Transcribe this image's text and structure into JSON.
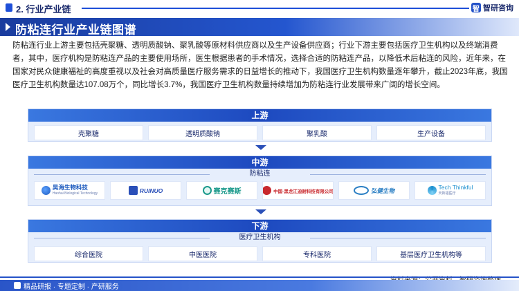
{
  "header": {
    "section_label": "2. 行业产业链",
    "brand_logo_letter": "智",
    "brand_name": "智研咨询"
  },
  "title": "防粘连行业产业链图谱",
  "intro": "防粘连行业上游主要包括壳聚糖、透明质酸钠、聚乳酸等原材料供应商以及生产设备供应商；行业下游主要包括医疗卫生机构以及终端消费者，其中，医疗机构是防粘连产品的主要使用场所，医生根据患者的手术情况，选择合适的防粘连产品，以降低术后粘连的风险，近年来，在国家对民众健康福祉的高度重视以及社会对高质量医疗服务需求的日益增长的推动下，我国医疗卫生机构数量逐年攀升，截止2023年底，我国医疗卫生机构数量达107.08万个，同比增长3.7%，我国医疗卫生机构数量持续增加为防粘连行业发展带来广阔的增长空间。",
  "upstream": {
    "title": "上游",
    "items": [
      "壳聚糖",
      "透明质酸钠",
      "聚乳酸",
      "生产设备"
    ]
  },
  "midstream": {
    "title": "中游",
    "sub_label": "防粘连",
    "logos": [
      {
        "name": "昊海生物科技",
        "sub": "Haohai Biological Technology",
        "color": "#1e5bbf"
      },
      {
        "name": "RUINUO",
        "sub": "",
        "color": "#2a4fb8"
      },
      {
        "name": "赛克赛斯",
        "sub": "",
        "color": "#1c9a8c"
      },
      {
        "name": "中国·黑龙江迪耐科技有限公司",
        "sub": "",
        "color": "#c8282d"
      },
      {
        "name": "弘健生物",
        "sub": "",
        "color": "#2b7fc4"
      },
      {
        "name": "Tech Thinkful",
        "sub": "天新福医疗",
        "color": "#1b8fcf"
      }
    ]
  },
  "downstream": {
    "title": "下游",
    "sub_label": "医疗卫生机构",
    "items": [
      "综合医院",
      "中医医院",
      "专科医院",
      "基层医疗卫生机构等"
    ]
  },
  "source": "资料来源：公开资料、智研咨询整理",
  "footer": "精品研报 · 专题定制 · 产研服务"
}
